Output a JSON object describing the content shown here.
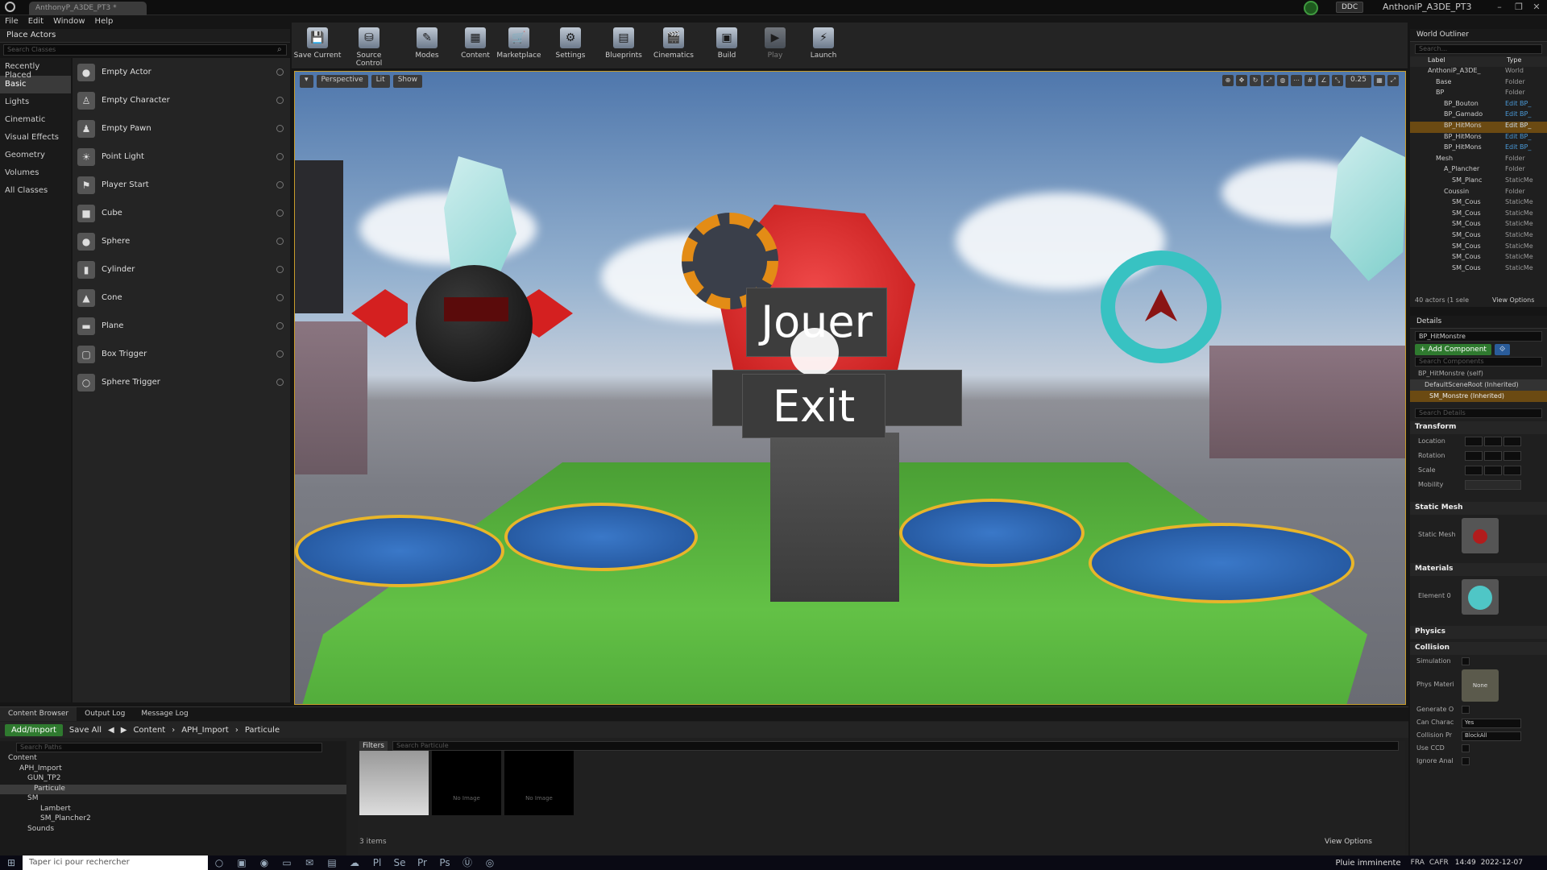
{
  "window": {
    "doc_tab": "AnthonyP_A3DE_PT3 *",
    "project": "AnthoniP_A3DE_PT3",
    "ddc": "DDC"
  },
  "menu": [
    "File",
    "Edit",
    "Window",
    "Help"
  ],
  "place_actors": {
    "tab": "Place Actors",
    "search_placeholder": "Search Classes",
    "categories": [
      "Recently Placed",
      "Basic",
      "Lights",
      "Cinematic",
      "Visual Effects",
      "Geometry",
      "Volumes",
      "All Classes"
    ],
    "selected_category": "Basic",
    "actors": [
      {
        "label": "Empty Actor",
        "icon": "sphere-icon"
      },
      {
        "label": "Empty Character",
        "icon": "character-icon"
      },
      {
        "label": "Empty Pawn",
        "icon": "pawn-icon"
      },
      {
        "label": "Point Light",
        "icon": "lightbulb-icon"
      },
      {
        "label": "Player Start",
        "icon": "flag-icon"
      },
      {
        "label": "Cube",
        "icon": "cube-icon"
      },
      {
        "label": "Sphere",
        "icon": "sphere-icon"
      },
      {
        "label": "Cylinder",
        "icon": "cylinder-icon"
      },
      {
        "label": "Cone",
        "icon": "cone-icon"
      },
      {
        "label": "Plane",
        "icon": "plane-icon"
      },
      {
        "label": "Box Trigger",
        "icon": "box-trigger-icon"
      },
      {
        "label": "Sphere Trigger",
        "icon": "sphere-trigger-icon"
      }
    ]
  },
  "toolbar": [
    "Save Current",
    "Source Control",
    "Modes",
    "Content",
    "Marketplace",
    "Settings",
    "Blueprints",
    "Cinematics",
    "Build",
    "Play",
    "Launch"
  ],
  "viewport": {
    "perspective": "Perspective",
    "lit": "Lit",
    "show": "Show",
    "zoom": "0.25",
    "menu": {
      "play": "Jouer",
      "exit": "Exit"
    }
  },
  "outliner": {
    "tab": "World Outliner",
    "search_placeholder": "Search...",
    "col_label": "Label",
    "col_type": "Type",
    "rows": [
      {
        "label": "AnthoniP_A3DE_",
        "type": "World"
      },
      {
        "label": "Base",
        "type": "Folder"
      },
      {
        "label": "BP",
        "type": "Folder"
      },
      {
        "label": "BP_Bouton",
        "type": "Edit BP_"
      },
      {
        "label": "BP_Gamado",
        "type": "Edit BP_"
      },
      {
        "label": "BP_HitMons",
        "type": "Edit BP_"
      },
      {
        "label": "BP_HitMons",
        "type": "Edit BP_"
      },
      {
        "label": "BP_HitMons",
        "type": "Edit BP_"
      },
      {
        "label": "Mesh",
        "type": "Folder"
      },
      {
        "label": "A_Plancher",
        "type": "Folder"
      },
      {
        "label": "SM_Planc",
        "type": "StaticMe"
      },
      {
        "label": "Coussin",
        "type": "Folder"
      },
      {
        "label": "SM_Cous",
        "type": "StaticMe"
      },
      {
        "label": "SM_Cous",
        "type": "StaticMe"
      },
      {
        "label": "SM_Cous",
        "type": "StaticMe"
      },
      {
        "label": "SM_Cous",
        "type": "StaticMe"
      },
      {
        "label": "SM_Cous",
        "type": "StaticMe"
      },
      {
        "label": "SM_Cous",
        "type": "StaticMe"
      },
      {
        "label": "SM_Cous",
        "type": "StaticMe"
      }
    ],
    "footer": "40 actors (1 sele",
    "view_options": "View Options"
  },
  "details": {
    "tab": "Details",
    "object": "BP_HitMonstre",
    "add_component": "+ Add Component",
    "search_components": "Search Components",
    "self": "BP_HitMonstre (self)",
    "root": "DefaultSceneRoot (Inherited)",
    "mesh": "SM_Monstre (Inherited)",
    "search_details": "Search Details",
    "sections": [
      "Transform",
      "Static Mesh",
      "Materials",
      "Physics",
      "Collision"
    ],
    "transform_rows": [
      "Location",
      "Rotation",
      "Scale",
      "Mobility"
    ],
    "static_mesh_label": "Static Mesh",
    "element0": "Element 0",
    "collision_rows": [
      "Simulation",
      "Phys Materi",
      "Generate O",
      "Can Charac",
      "Collision Pr",
      "Use CCD",
      "Ignore Anal"
    ],
    "can_charac": "Yes",
    "collision_preset": "BlockAll",
    "phys_none": "None"
  },
  "content_browser": {
    "tabs": [
      "Content Browser",
      "Output Log",
      "Message Log"
    ],
    "add_import": "Add/Import",
    "save_all": "Save All",
    "path": [
      "Content",
      "APH_Import",
      "Particule"
    ],
    "search_paths": "Search Paths",
    "filters": "Filters",
    "search_assets": "Search Particule",
    "tree": [
      "Content",
      "APH_Import",
      "GUN_TP2",
      "Particule",
      "SM",
      "Lambert",
      "SM_Plancher2",
      "Sounds"
    ],
    "items_count": "3 items",
    "view_options": "View Options",
    "no_image": "No Image"
  },
  "taskbar": {
    "search": "Taper ici pour rechercher",
    "weather": "Pluie imminente",
    "lang": "FRA",
    "region": "CAFR",
    "time": "14:49",
    "date": "2022-12-07"
  }
}
